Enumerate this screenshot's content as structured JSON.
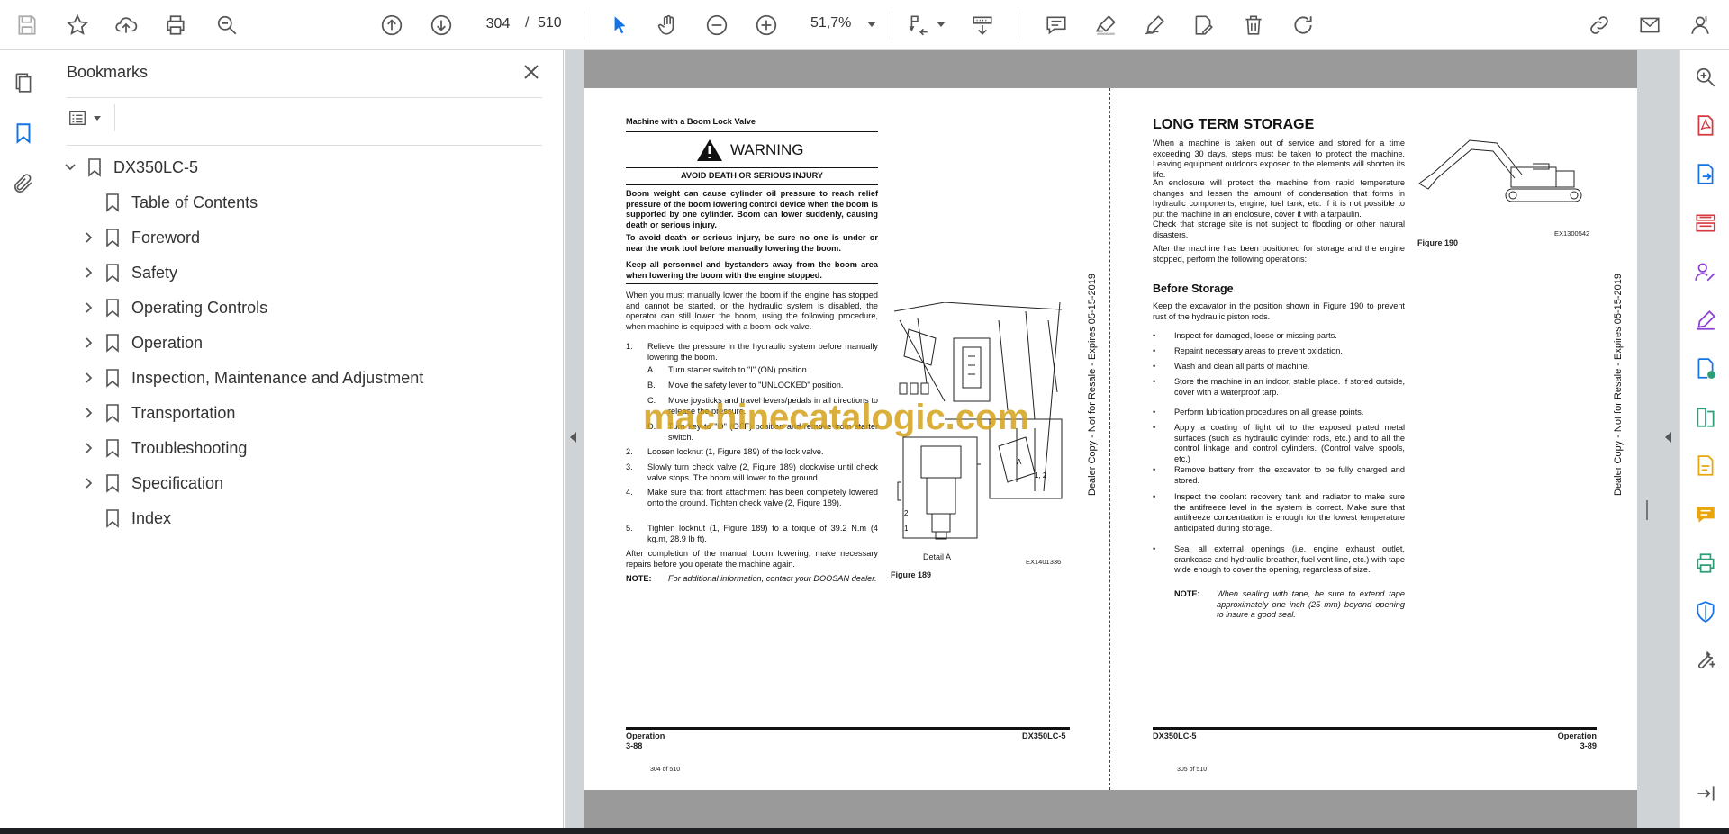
{
  "toolbar": {
    "icons": [
      "save-icon",
      "bookmark-star-icon",
      "upload-icon",
      "print-icon",
      "find-icon",
      "page-up-icon",
      "page-down-icon",
      "select-pointer-icon",
      "hand-icon",
      "zoom-out-icon",
      "zoom-in-icon",
      "fit-page-icon",
      "scroll-mode-icon",
      "comment-icon",
      "highlight-icon",
      "sign-icon",
      "fill-icon",
      "delete-icon",
      "rotate-icon",
      "share-link-icon",
      "email-icon",
      "account-icon"
    ],
    "current_page": "304",
    "page_separator": "/",
    "total_pages": "510",
    "zoom": "51,7%"
  },
  "bookmarks": {
    "title": "Bookmarks",
    "root": "DX350LC-5",
    "items": [
      {
        "label": "Table of Contents",
        "expandable": false
      },
      {
        "label": "Foreword",
        "expandable": true
      },
      {
        "label": "Safety",
        "expandable": true
      },
      {
        "label": "Operating Controls",
        "expandable": true
      },
      {
        "label": "Operation",
        "expandable": true
      },
      {
        "label": "Inspection, Maintenance and Adjustment",
        "expandable": true
      },
      {
        "label": "Transportation",
        "expandable": true
      },
      {
        "label": "Troubleshooting",
        "expandable": true
      },
      {
        "label": "Specification",
        "expandable": true
      },
      {
        "label": "Index",
        "expandable": false
      }
    ]
  },
  "document": {
    "left": {
      "heading": "Machine with a Boom Lock Valve",
      "warning_title": "WARNING",
      "warning_sub": "AVOID DEATH OR SERIOUS INJURY",
      "warn_p1": "Boom weight can cause cylinder oil pressure to reach relief pressure of the boom lowering control device when the boom is supported by one cylinder. Boom can lower suddenly, causing death or serious injury.",
      "warn_p2": "To avoid death or serious injury, be sure no one is under or near the work tool before manually lowering the boom.",
      "warn_p3": "Keep all personnel and bystanders away from the boom area when lowering the boom with the engine stopped.",
      "intro": "When you must manually lower the boom if the engine has stopped and cannot be started, or the hydraulic system is disabled, the operator can still lower the boom, using the following procedure, when machine is equipped with a boom lock valve.",
      "step1": "Relieve the pressure in the hydraulic system before manually lowering the boom.",
      "step1a": "Turn starter switch to \"I\" (ON) position.",
      "step1b": "Move the safety lever to \"UNLOCKED\" position.",
      "step1c": "Move joysticks and travel levers/pedals in all directions to release the pressure.",
      "step1d": "Turn key to \"O\" (OFF) position and remove from starter switch.",
      "step2": "Loosen locknut (1, Figure 189) of the lock valve.",
      "step3": "Slowly turn check valve (2, Figure 189) clockwise until check valve stops. The boom will lower to the ground.",
      "step4": "Make sure that front attachment has been completely lowered onto the ground. Tighten check valve (2, Figure 189).",
      "step5": "Tighten locknut (1, Figure 189) to a torque of 39.2 N.m (4 kg.m, 28.9 lb ft).",
      "after": "After completion of the manual boom lowering, make necessary repairs before you operate the machine again.",
      "note_label": "NOTE:",
      "note": "For additional information, contact your DOOSAN dealer.",
      "fig_caption": "Figure 189",
      "fig_code": "EX1401336",
      "detail": "Detail A",
      "footer_left_title": "Operation",
      "footer_left_page": "3-88",
      "footer_left_model": "DX350LC-5",
      "page_num": "304 of 510",
      "side_text": "Dealer Copy - Not for Resale - Expires 05-15-2019"
    },
    "right": {
      "heading": "LONG TERM STORAGE",
      "p1": "When a machine is taken out of service and stored for a time exceeding 30 days, steps must be taken to protect the machine. Leaving equipment outdoors exposed to the elements will shorten its life.",
      "p2": "An enclosure will protect the machine from rapid temperature changes and lessen the amount of condensation that forms in hydraulic components, engine, fuel tank, etc. If it is not possible to put the machine in an enclosure, cover it with a tarpaulin.",
      "p3": "Check that storage site is not subject to flooding or other natural disasters.",
      "p4": "After the machine has been positioned for storage and the engine stopped, perform the following operations:",
      "sub": "Before Storage",
      "p5": "Keep the excavator in the position shown in Figure 190 to prevent rust of the hydraulic piston rods.",
      "bullets": [
        "Inspect for damaged, loose or missing parts.",
        "Repaint necessary areas to prevent oxidation.",
        "Wash and clean all parts of machine.",
        "Store the machine in an indoor, stable place. If stored outside, cover with a waterproof tarp.",
        "Perform lubrication procedures on all grease points.",
        "Apply a coating of light oil to the exposed plated metal surfaces (such as hydraulic cylinder rods, etc.) and to all the control linkage and control cylinders. (Control valve spools, etc.)",
        "Remove battery from the excavator to be fully charged and stored.",
        "Inspect the coolant recovery tank and radiator to make sure the antifreeze level in the system is correct. Make sure that antifreeze concentration is enough for the lowest temperature anticipated during storage.",
        "Seal all external openings (i.e. engine exhaust outlet, crankcase and hydraulic breather, fuel vent line, etc.) with tape wide enough to cover the opening, regardless of size."
      ],
      "note_label": "NOTE:",
      "note": "When sealing with tape, be sure to extend tape approximately one inch (25 mm) beyond opening to insure a good seal.",
      "fig_caption": "Figure 190",
      "fig_code": "EX1300542",
      "footer_right_model": "DX350LC-5",
      "footer_right_title": "Operation",
      "footer_right_page": "3-89",
      "page_num": "305 of 510",
      "side_text": "Dealer Copy - Not for Resale - Expires 05-15-2019"
    },
    "watermark": "machinecatalogic.com"
  },
  "right_rail": {
    "icons": [
      "zoom-search-icon",
      "create-pdf-icon",
      "export-pdf-icon",
      "organize-pages-icon",
      "request-signature-icon",
      "fill-sign-icon",
      "send-for-review-icon",
      "compare-icon",
      "edit-pdf-icon",
      "comment-tool-icon",
      "print-production-icon",
      "protect-icon",
      "more-tools-icon",
      "collapse-panel-icon"
    ]
  },
  "colors": {
    "accent": "#1473e6",
    "tool_red": "#d7373f",
    "tool_purple": "#8a3fd6",
    "tool_green": "#2d9d78",
    "tool_yellow": "#e8a50c"
  }
}
